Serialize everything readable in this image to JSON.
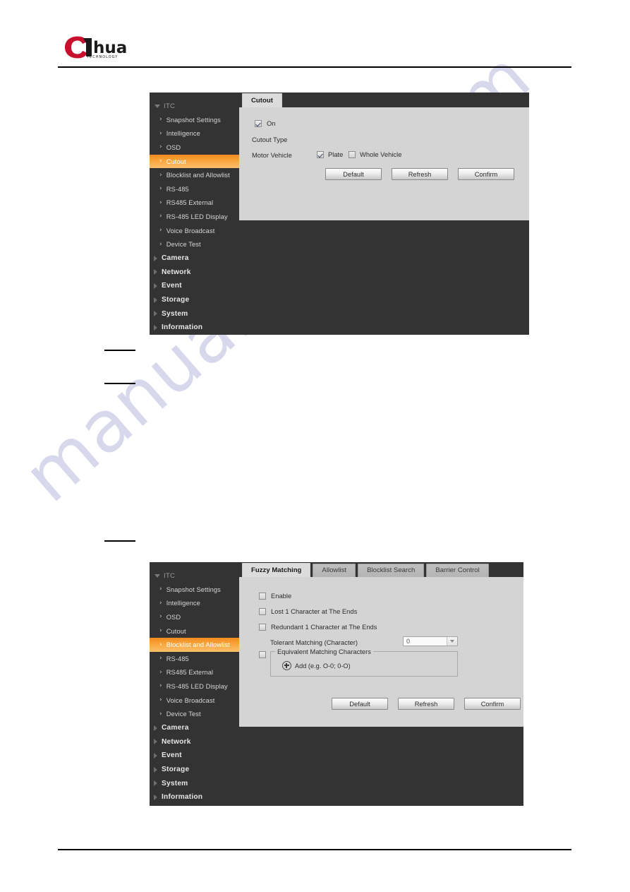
{
  "header": {
    "logo_text": "alhua",
    "logo_sub": "TECHNOLOGY",
    "logo_red": "#c8102e"
  },
  "watermark": {
    "text": "manualshive.com",
    "color": "#3b3f9e"
  },
  "sidebar": {
    "root_label": "ITC",
    "children": [
      "Snapshot Settings",
      "Intelligence",
      "OSD",
      "Cutout",
      "Blocklist and Allowlist",
      "RS-485",
      "RS485 External",
      "RS-485 LED Display",
      "Voice Broadcast",
      "Device Test"
    ],
    "groups": [
      "Camera",
      "Network",
      "Event",
      "Storage",
      "System",
      "Information"
    ],
    "active_highlight_color": "#f59a2e"
  },
  "screenshot_cutout": {
    "tabs": [
      {
        "label": "Cutout",
        "active": true
      }
    ],
    "on_checkbox": {
      "label": "On",
      "checked": true
    },
    "cutout_type_label": "Cutout Type",
    "motor_vehicle_label": "Motor Vehicle",
    "options": [
      {
        "label": "Plate",
        "checked": true
      },
      {
        "label": "Whole Vehicle",
        "checked": false
      }
    ],
    "buttons": [
      "Default",
      "Refresh",
      "Confirm"
    ],
    "active_sidebar_index": 3
  },
  "screenshot_fuzzy": {
    "tabs": [
      {
        "label": "Fuzzy Matching",
        "active": true
      },
      {
        "label": "Allowlist",
        "active": false
      },
      {
        "label": "Blocklist Search",
        "active": false
      },
      {
        "label": "Barrier Control",
        "active": false
      }
    ],
    "enable_checkbox": {
      "label": "Enable",
      "checked": false
    },
    "lost_checkbox": {
      "label": "Lost 1 Character at The Ends",
      "checked": false
    },
    "redundant_checkbox": {
      "label": "Redundant 1 Character at The Ends",
      "checked": false
    },
    "tolerant_label": "Tolerant Matching (Character)",
    "tolerant_value": "0",
    "equivalent_checkbox": {
      "label": "Equivalent Matching Characters",
      "checked": false
    },
    "add_label": "Add (e.g. O-0; 0-O)",
    "buttons": [
      "Default",
      "Refresh",
      "Confirm"
    ],
    "active_sidebar_index": 4
  }
}
